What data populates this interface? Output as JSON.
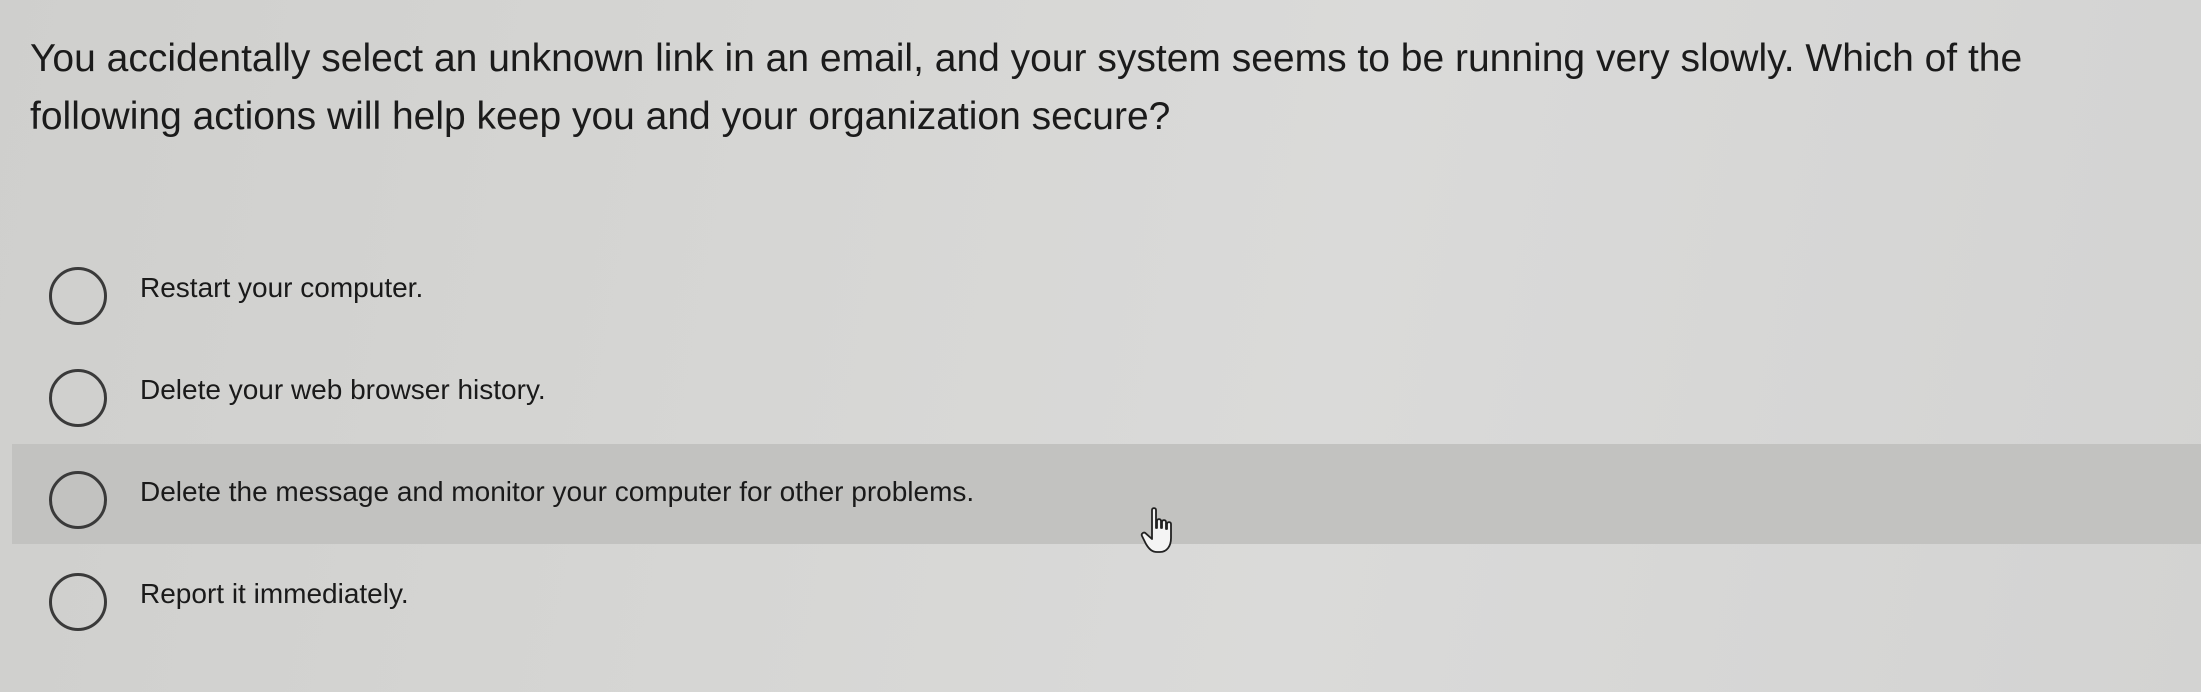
{
  "question": {
    "text": "You accidentally select an unknown link in an email, and your system seems to be running very slowly. Which of the following actions will help keep you and your organization secure?"
  },
  "options": [
    {
      "label": "Restart your computer.",
      "selected": false
    },
    {
      "label": "Delete your web browser history.",
      "selected": false
    },
    {
      "label": "Delete the message and monitor your computer for other problems.",
      "selected": false,
      "hovered": true
    },
    {
      "label": "Report it immediately.",
      "selected": false
    }
  ],
  "colors": {
    "background": "#d6d6d4",
    "hover_row": "#c2c2c0",
    "text": "#1b1b1b",
    "radio_border": "#3a3a3a"
  },
  "icons": {
    "cursor": "hand-pointer-icon"
  }
}
